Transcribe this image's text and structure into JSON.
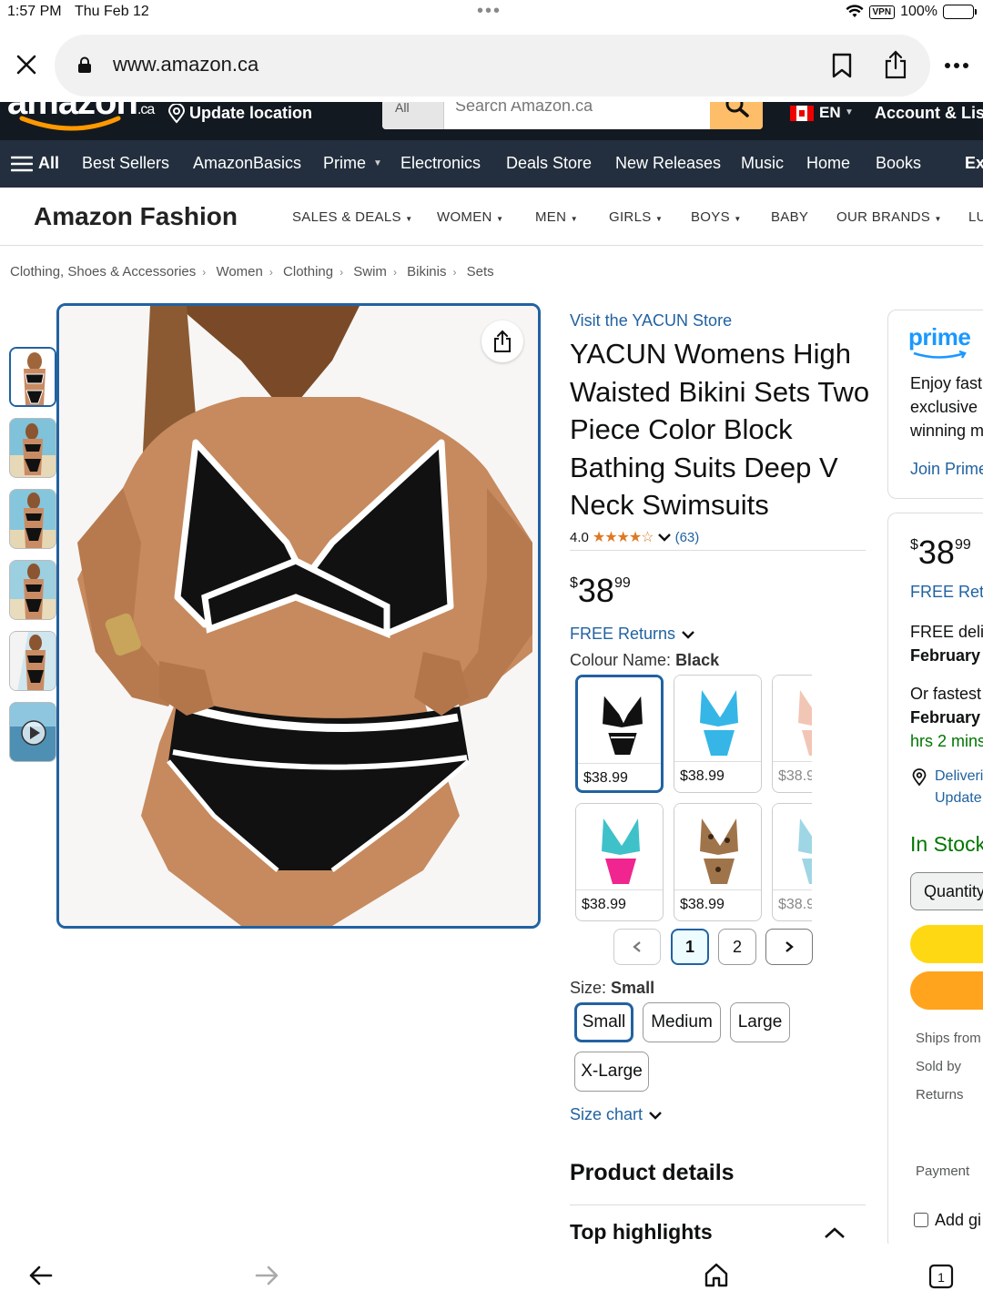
{
  "status": {
    "time": "1:57 PM",
    "date": "Thu Feb 12",
    "vpn": "VPN",
    "battery": "100%"
  },
  "browser": {
    "url": "www.amazon.ca"
  },
  "header": {
    "logo_suffix": ".ca",
    "update_location": "Update location",
    "search_category": "All",
    "search_placeholder": "Search Amazon.ca",
    "language": "EN",
    "account": "Account & Lists"
  },
  "nav": {
    "all": "All",
    "items": [
      "Best Sellers",
      "AmazonBasics",
      "Prime",
      "Electronics",
      "Deals Store",
      "New Releases",
      "Music",
      "Home",
      "Books",
      "Ex"
    ]
  },
  "fashion": {
    "brand": "Amazon Fashion",
    "items": [
      "SALES & DEALS",
      "WOMEN",
      "MEN",
      "GIRLS",
      "BOYS",
      "BABY",
      "OUR BRANDS",
      "LU"
    ]
  },
  "breadcrumb": [
    "Clothing, Shoes & Accessories",
    "Women",
    "Clothing",
    "Swim",
    "Bikinis",
    "Sets"
  ],
  "product": {
    "store_link": "Visit the YACUN Store",
    "title": "YACUN Womens High Waisted Bikini Sets Two Piece Color Block Bathing Suits Deep V Neck Swimsuits",
    "rating": "4.0",
    "stars": 4,
    "review_count": "(63)",
    "price_symbol": "$",
    "price_whole": "38",
    "price_fraction": "99",
    "free_returns": "FREE Returns",
    "colour_label": "Colour Name:",
    "colour_value": "Black",
    "swatches": [
      {
        "price": "$38.99",
        "colors": [
          "#111111",
          "#ffffff"
        ]
      },
      {
        "price": "$38.99",
        "colors": [
          "#35b6e6",
          "#35b6e6"
        ]
      },
      {
        "price": "$38.9",
        "colors": [
          "#f2c6b5",
          "#f2c6b5"
        ]
      },
      {
        "price": "$38.99",
        "colors": [
          "#3fc1c9",
          "#f0258f"
        ]
      },
      {
        "price": "$38.99",
        "colors": [
          "#a0744a",
          "#a0744a"
        ]
      },
      {
        "price": "$38.9",
        "colors": [
          "#9fd6e6",
          "#9fd6e6"
        ]
      }
    ],
    "pages": [
      "1",
      "2"
    ],
    "size_label": "Size:",
    "size_value": "Small",
    "sizes": [
      "Small",
      "Medium",
      "Large",
      "X-Large"
    ],
    "size_chart": "Size chart",
    "details_heading": "Product details",
    "highlights_heading": "Top highlights"
  },
  "prime_box": {
    "logo": "prime",
    "line1": "Enjoy fast",
    "line2": "exclusive",
    "line3": "winning m",
    "join": "Join Prime"
  },
  "buy_box": {
    "price_symbol": "$",
    "price_whole": "38",
    "price_fraction": "99",
    "free_returns": "FREE Retu",
    "free_delivery": "FREE deliv",
    "delivery_date": "February",
    "fastest": "Or fastest",
    "fastest_date": "February",
    "countdown": "hrs 2 mins",
    "deliver_to": "Deliveri",
    "update": "Update",
    "stock": "In Stock",
    "quantity": "Quantity",
    "ships_from": "Ships from",
    "sold_by": "Sold by",
    "returns": "Returns",
    "payment": "Payment",
    "add_gift": "Add gi"
  },
  "colors": {
    "link": "#2162a1",
    "amazon_dark": "#131921",
    "amazon_nav": "#232f3e",
    "add_to_cart": "#ffd814",
    "buy_now": "#ffa41c",
    "stars": "#de7921",
    "stock": "#007600"
  }
}
